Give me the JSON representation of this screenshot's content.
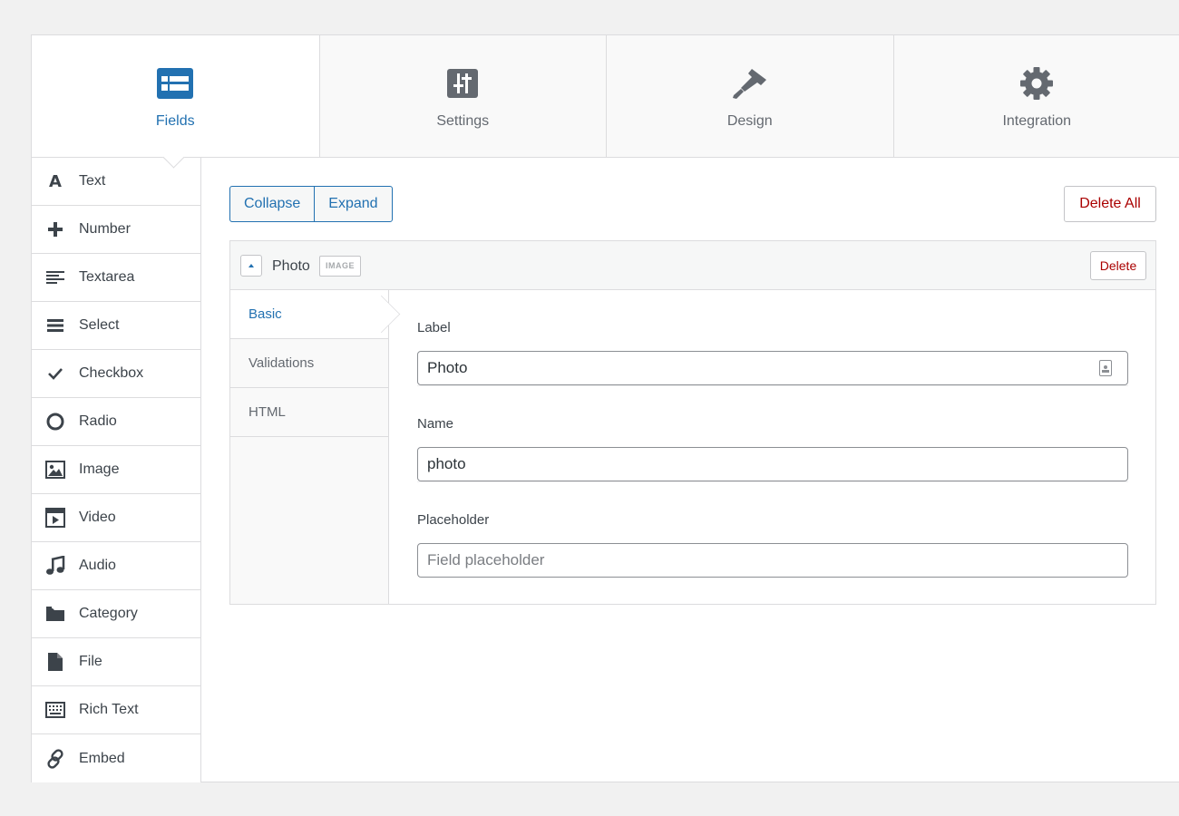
{
  "tabs": [
    {
      "label": "Fields",
      "icon": "fields-icon",
      "active": true
    },
    {
      "label": "Settings",
      "icon": "sliders-icon",
      "active": false
    },
    {
      "label": "Design",
      "icon": "paintbrush-icon",
      "active": false
    },
    {
      "label": "Integration",
      "icon": "gear-icon",
      "active": false
    }
  ],
  "sidebar": {
    "items": [
      {
        "label": "Text",
        "icon": "text-icon"
      },
      {
        "label": "Number",
        "icon": "plus-icon"
      },
      {
        "label": "Textarea",
        "icon": "textarea-icon"
      },
      {
        "label": "Select",
        "icon": "list-icon"
      },
      {
        "label": "Checkbox",
        "icon": "checkmark-icon"
      },
      {
        "label": "Radio",
        "icon": "radio-icon"
      },
      {
        "label": "Image",
        "icon": "image-icon"
      },
      {
        "label": "Video",
        "icon": "video-icon"
      },
      {
        "label": "Audio",
        "icon": "music-note-icon"
      },
      {
        "label": "Category",
        "icon": "folder-icon"
      },
      {
        "label": "File",
        "icon": "file-icon"
      },
      {
        "label": "Rich Text",
        "icon": "keyboard-icon"
      },
      {
        "label": "Embed",
        "icon": "link-icon"
      }
    ]
  },
  "toolbar": {
    "collapse_label": "Collapse",
    "expand_label": "Expand",
    "delete_all_label": "Delete All"
  },
  "field": {
    "title": "Photo",
    "type_badge": "IMAGE",
    "delete_label": "Delete",
    "subtabs": [
      {
        "label": "Basic",
        "active": true
      },
      {
        "label": "Validations",
        "active": false
      },
      {
        "label": "HTML",
        "active": false
      }
    ],
    "basic": {
      "label_title": "Label",
      "label_value": "Photo",
      "name_title": "Name",
      "name_value": "photo",
      "placeholder_title": "Placeholder",
      "placeholder_placeholder": "Field placeholder"
    }
  },
  "colors": {
    "accent": "#2271b1",
    "danger": "#aa0000",
    "icon": "#646970"
  }
}
